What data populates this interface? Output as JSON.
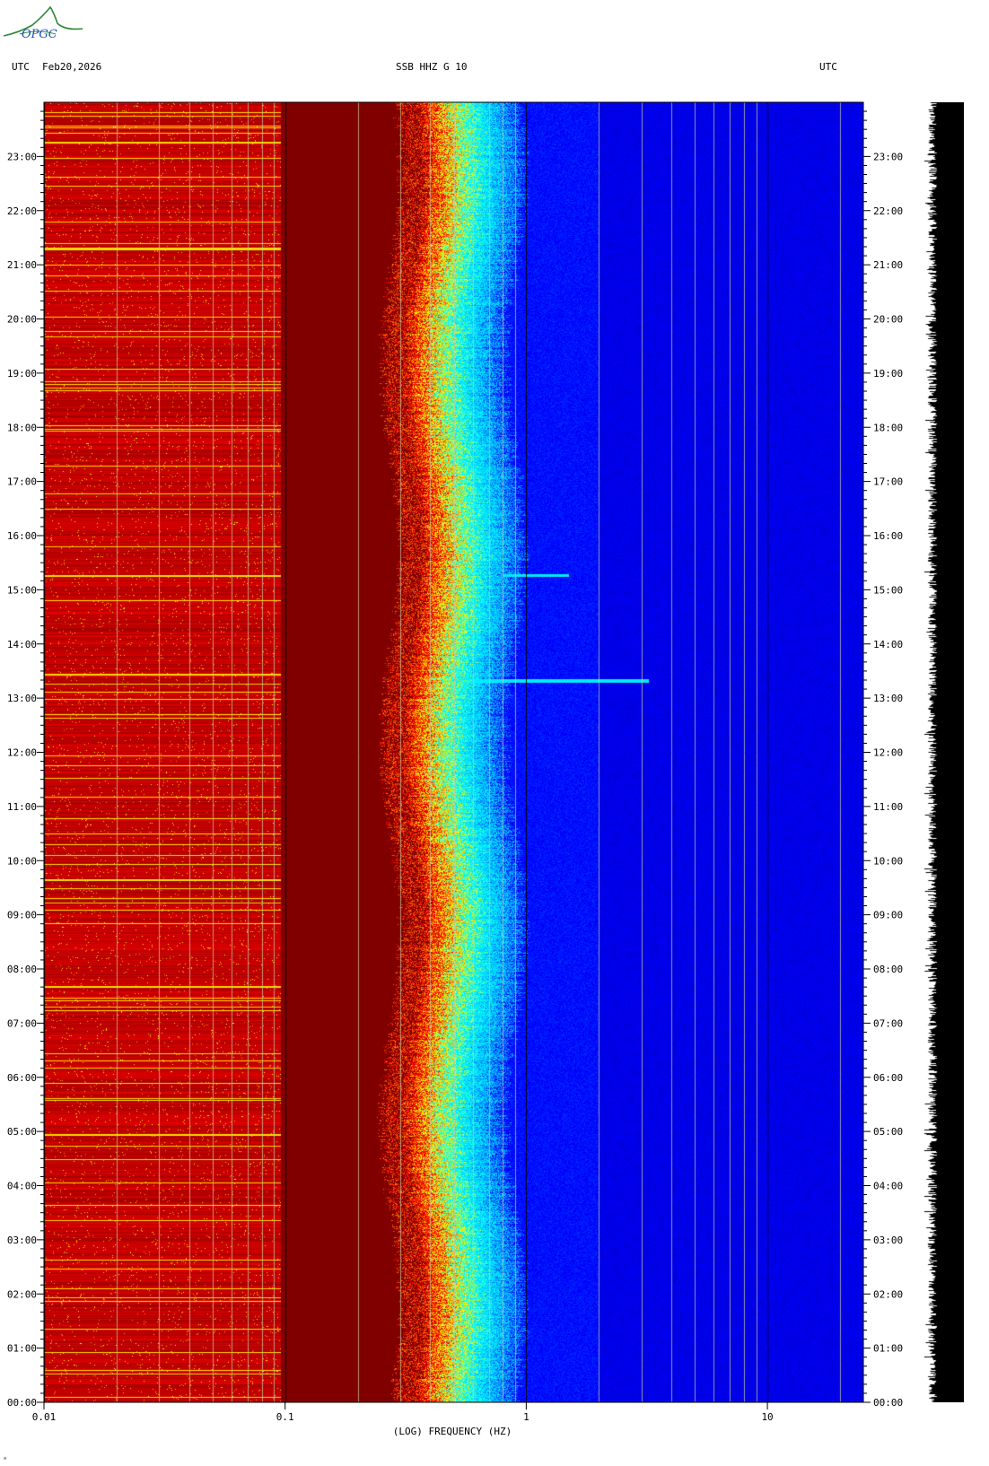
{
  "header": {
    "left_tz": "UTC",
    "date": "Feb20,2026",
    "station": "SSB HHZ G 10",
    "right_tz": "UTC"
  },
  "logo": {
    "text": "OPGC",
    "icon": "mountain-logo-icon"
  },
  "chart_data": {
    "type": "heatmap",
    "title": "SSB HHZ G 10",
    "xlabel": "(LOG) FREQUENCY (HZ)",
    "x_scale": "log",
    "xlim": [
      0.01,
      25
    ],
    "x_ticks": [
      {
        "value": 0.01,
        "label": "0.01"
      },
      {
        "value": 0.1,
        "label": "0.1"
      },
      {
        "value": 1,
        "label": "1"
      },
      {
        "value": 10,
        "label": "10"
      }
    ],
    "y_unit": "hour UTC",
    "ylim": [
      0,
      24
    ],
    "y_ticks": [
      "00:00",
      "01:00",
      "02:00",
      "03:00",
      "04:00",
      "05:00",
      "06:00",
      "07:00",
      "08:00",
      "09:00",
      "10:00",
      "11:00",
      "12:00",
      "13:00",
      "14:00",
      "15:00",
      "16:00",
      "17:00",
      "18:00",
      "19:00",
      "20:00",
      "21:00",
      "22:00",
      "23:00"
    ],
    "colormap": [
      "#00008a",
      "#0000ff",
      "#00ffff",
      "#ffff00",
      "#ff0000",
      "#800000"
    ],
    "transition_band_hz": [
      0.35,
      0.9
    ],
    "events": [
      {
        "time": 13.33,
        "f_min": 0.45,
        "f_max": 3.2
      },
      {
        "time": 15.27,
        "f_min": 0.8,
        "f_max": 1.5
      }
    ],
    "grid": true
  },
  "footer": {
    "mark": "ᵃ"
  }
}
